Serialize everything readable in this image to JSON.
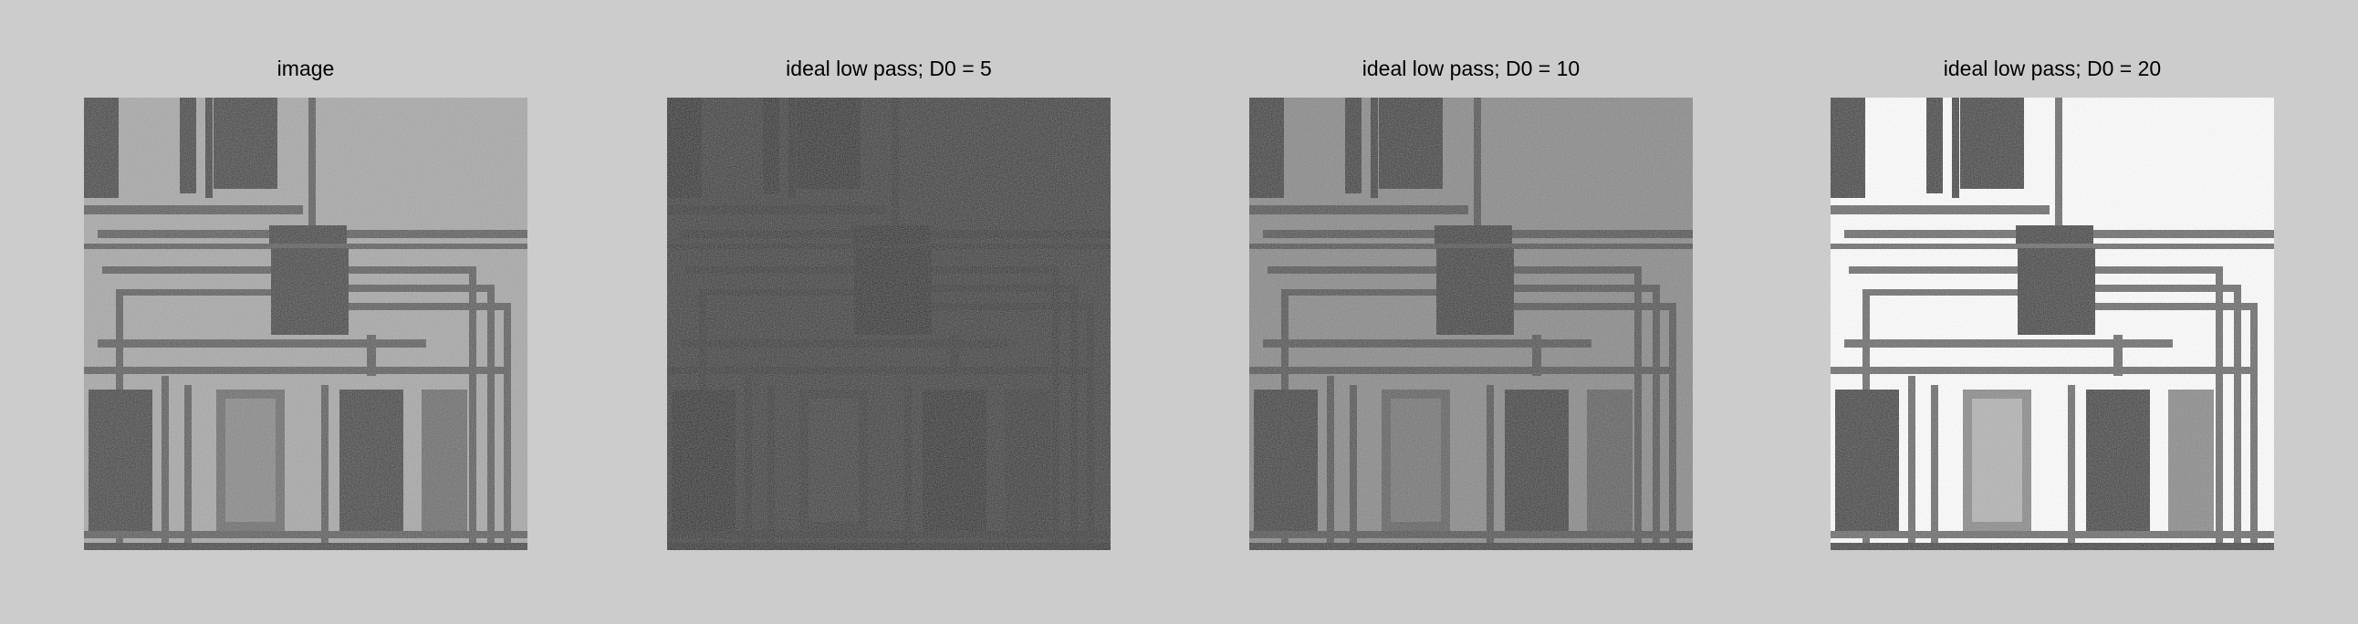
{
  "figure": {
    "background": "#cccccc",
    "panels": [
      {
        "title": "image",
        "tone": "original"
      },
      {
        "title": "ideal low pass; D0 = 5",
        "tone": "dark"
      },
      {
        "title": "ideal low pass; D0 = 10",
        "tone": "medium"
      },
      {
        "title": "ideal low pass; D0 = 20",
        "tone": "bright"
      }
    ]
  }
}
